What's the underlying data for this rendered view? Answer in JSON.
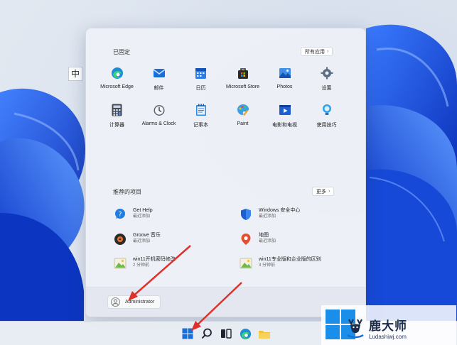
{
  "ime_indicator": "中",
  "start_menu": {
    "pinned_title": "已固定",
    "all_apps_label": "所有应用",
    "pinned_apps": [
      {
        "label": "Microsoft Edge",
        "icon": "edge-icon"
      },
      {
        "label": "邮件",
        "icon": "mail-icon"
      },
      {
        "label": "日历",
        "icon": "calendar-icon"
      },
      {
        "label": "Microsoft Store",
        "icon": "store-icon"
      },
      {
        "label": "Photos",
        "icon": "photos-icon"
      },
      {
        "label": "设置",
        "icon": "settings-icon"
      },
      {
        "label": "计算器",
        "icon": "calculator-icon"
      },
      {
        "label": "Alarms & Clock",
        "icon": "clock-icon"
      },
      {
        "label": "记事本",
        "icon": "notepad-icon"
      },
      {
        "label": "Paint",
        "icon": "paint-icon"
      },
      {
        "label": "电影和电视",
        "icon": "movies-icon"
      },
      {
        "label": "使用技巧",
        "icon": "tips-icon"
      }
    ],
    "recommended_title": "推荐的项目",
    "more_label": "更多",
    "recommended": [
      {
        "title": "Get Help",
        "subtitle": "最近添加",
        "icon": "help-icon"
      },
      {
        "title": "Windows 安全中心",
        "subtitle": "最近添加",
        "icon": "shield-icon"
      },
      {
        "title": "Groove 音乐",
        "subtitle": "最近添加",
        "icon": "groove-icon"
      },
      {
        "title": "地图",
        "subtitle": "最近添加",
        "icon": "maps-icon"
      },
      {
        "title": "win11开机密码修改",
        "subtitle": "2 分钟前",
        "icon": "image-file-icon"
      },
      {
        "title": "win11专业版和企业版的区别",
        "subtitle": "3 分钟前",
        "icon": "image-file-icon"
      }
    ],
    "user_name": "Administrator"
  },
  "watermark": {
    "main": "鹿大师",
    "sub": "Ludashiwj.com"
  },
  "colors": {
    "accent": "#1a6ed8",
    "arrow": "#e0302a"
  }
}
